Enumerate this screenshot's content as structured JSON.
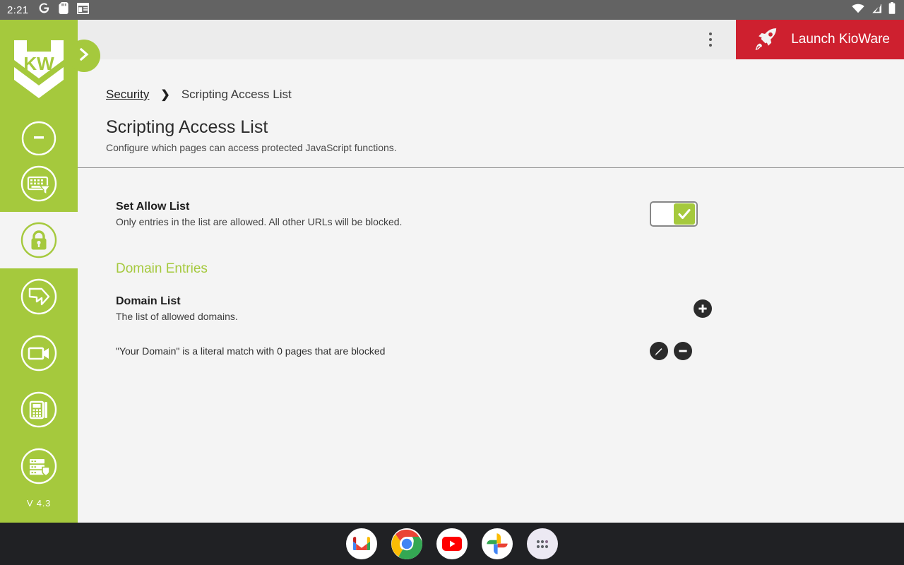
{
  "statusbar": {
    "time": "2:21",
    "left_icons": [
      "google-g-icon",
      "sd-card-icon",
      "window-layout-icon"
    ],
    "right_icons": [
      "wifi-icon",
      "cell-signal-icon",
      "battery-icon"
    ]
  },
  "topbar": {
    "overflow_menu": "overflow-menu-icon",
    "launch_label": "Launch KioWare",
    "launch_icon": "rocket-icon",
    "launch_color": "#ce202f"
  },
  "sidebar": {
    "logo_alt": "kioware-logo",
    "accent": "#a5c93d",
    "version": "V 4.3",
    "collapse_icon": "chevron-right-icon",
    "items": [
      {
        "name": "sidebar-item-partial-top",
        "icon": "circle-partial-icon",
        "label": "",
        "active": false
      },
      {
        "name": "sidebar-item-input",
        "icon": "keyboard-filter-icon",
        "label": "",
        "active": false
      },
      {
        "name": "sidebar-item-security",
        "icon": "lock-icon",
        "label": "",
        "active": true
      },
      {
        "name": "sidebar-item-tags",
        "icon": "tag-icon",
        "label": "",
        "active": false
      },
      {
        "name": "sidebar-item-media",
        "icon": "video-camera-icon",
        "label": "",
        "active": false
      },
      {
        "name": "sidebar-item-devices",
        "icon": "payment-terminal-icon",
        "label": "",
        "active": false
      },
      {
        "name": "sidebar-item-server",
        "icon": "server-shield-icon",
        "label": "",
        "active": false
      }
    ]
  },
  "breadcrumb": {
    "parent": "Security",
    "separator": "❯",
    "current": "Scripting Access List"
  },
  "page": {
    "title": "Scripting Access List",
    "subtitle": "Configure which pages can access protected JavaScript functions."
  },
  "settings": {
    "allow_list": {
      "title": "Set Allow List",
      "description": "Only entries in the list are allowed. All other URLs will be blocked.",
      "checked": true,
      "check_icon": "checkmark-icon"
    }
  },
  "domain_entries": {
    "section_title": "Domain Entries",
    "domain_list": {
      "title": "Domain List",
      "description": "The list of allowed domains.",
      "add_icon": "plus-icon"
    },
    "entries": [
      {
        "text": "\"Your Domain\" is a literal match with 0 pages that are blocked",
        "edit_icon": "pencil-icon",
        "remove_icon": "minus-icon"
      }
    ]
  },
  "dock": {
    "apps": [
      {
        "name": "dock-app-gmail",
        "label": "Gmail"
      },
      {
        "name": "dock-app-chrome",
        "label": "Chrome"
      },
      {
        "name": "dock-app-youtube",
        "label": "YouTube"
      },
      {
        "name": "dock-app-photos",
        "label": "Photos"
      },
      {
        "name": "dock-app-drawer",
        "label": "All apps"
      }
    ]
  }
}
